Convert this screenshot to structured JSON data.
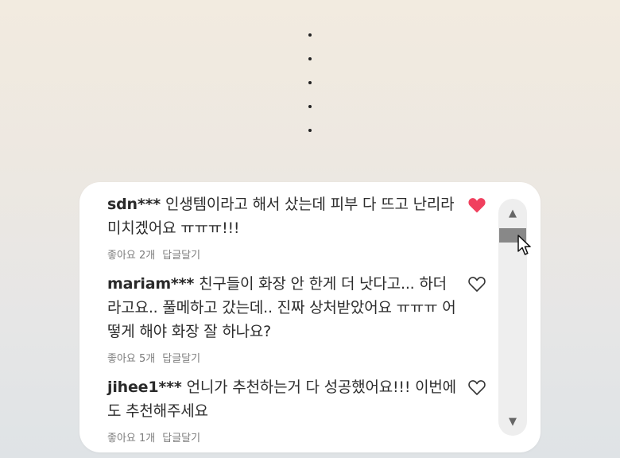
{
  "comments": [
    {
      "user": "sdn***",
      "text": "인생템이라고 해서 샀는데 피부 다 뜨고 난리라 미치겠어요 ㅠㅠㅠ!!!",
      "likes": "좋아요 2개",
      "reply": "답글달기",
      "liked": true
    },
    {
      "user": "mariam***",
      "text": "친구들이 화장 안 한게 더 낫다고... 하더라고요.. 풀메하고 갔는데.. 진짜 상처받았어요 ㅠㅠㅠ 어떻게 해야  화장 잘 하나요?",
      "likes": "좋아요 5개",
      "reply": "답글달기",
      "liked": false
    },
    {
      "user": "jihee1***",
      "text": "언니가 추천하는거 다 성공했어요!!! 이번에도 추천해주세요",
      "likes": "좋아요 1개",
      "reply": "답글달기",
      "liked": false
    }
  ],
  "icons": {
    "heart_filled": "heart-filled-icon",
    "heart_outline": "heart-outline-icon",
    "scroll_up": "▲",
    "scroll_down": "▼",
    "cursor": "mouse-pointer-icon"
  },
  "colors": {
    "heart_active": "#f0405e",
    "scroll_thumb": "#888888"
  }
}
